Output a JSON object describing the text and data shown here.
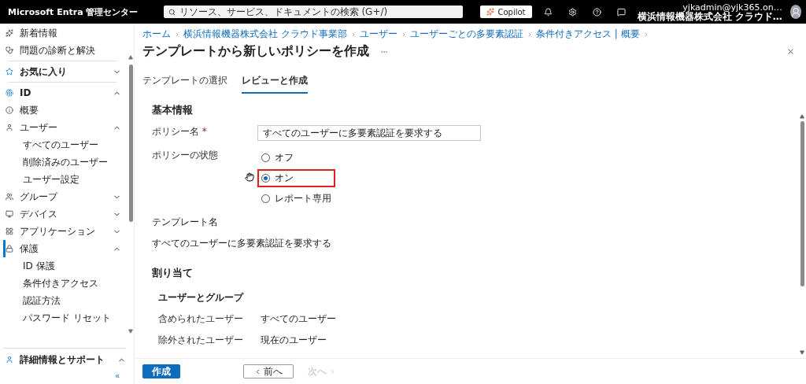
{
  "header": {
    "title": "Microsoft Entra 管理センター",
    "search": {
      "placeholder": "リソース、サービス、ドキュメントの検索 (G+/)"
    },
    "copilot": "Copilot",
    "account": {
      "email": "yjkadmin@yjk365.on…",
      "org": "横浜情報機器株式会社 クラウド…"
    }
  },
  "sidebar": {
    "items": [
      {
        "kind": "link",
        "label": "新着情報",
        "selected": false
      },
      {
        "kind": "link",
        "label": "問題の診断と解決",
        "selected": false
      },
      {
        "kind": "divider"
      },
      {
        "kind": "section",
        "label": "お気に入り",
        "expanded": false,
        "selected": false
      },
      {
        "kind": "divider"
      },
      {
        "kind": "section",
        "label": "ID",
        "expanded": true,
        "selected": false
      },
      {
        "kind": "link",
        "label": "概要",
        "selected": false
      },
      {
        "kind": "group",
        "label": "ユーザー",
        "expanded": true,
        "selected": false
      },
      {
        "kind": "sub",
        "label": "すべてのユーザー",
        "selected": false
      },
      {
        "kind": "sub",
        "label": "削除済みのユーザー",
        "selected": false
      },
      {
        "kind": "sub",
        "label": "ユーザー設定",
        "selected": false
      },
      {
        "kind": "group",
        "label": "グループ",
        "expanded": false,
        "selected": false
      },
      {
        "kind": "group",
        "label": "デバイス",
        "expanded": false,
        "selected": false
      },
      {
        "kind": "group",
        "label": "アプリケーション",
        "expanded": false,
        "selected": false
      },
      {
        "kind": "group",
        "label": "保護",
        "expanded": true,
        "selected": true
      },
      {
        "kind": "sub",
        "label": "ID 保護",
        "selected": false
      },
      {
        "kind": "sub",
        "label": "条件付きアクセス",
        "selected": false
      },
      {
        "kind": "sub",
        "label": "認証方法",
        "selected": false
      },
      {
        "kind": "sub",
        "label": "パスワード リセット",
        "selected": false
      }
    ],
    "footer": {
      "label": "詳細情報とサポート",
      "expanded": true
    },
    "collapse": "«"
  },
  "breadcrumb": [
    "ホーム",
    "横浜情報機器株式会社 クラウド事業部",
    "ユーザー",
    "ユーザーごとの多要素認証",
    "条件付きアクセス | 概要"
  ],
  "title": "テンプレートから新しいポリシーを作成",
  "tabs": [
    {
      "label": "テンプレートの選択",
      "selected": false
    },
    {
      "label": "レビューと作成",
      "selected": true
    }
  ],
  "basics": {
    "heading": "基本情報",
    "name_label": "ポリシー名",
    "required_mark": "*",
    "name_value": "すべてのユーザーに多要素認証を要求する",
    "state_label": "ポリシーの状態",
    "options": [
      {
        "label": "オフ",
        "selected": false,
        "highlighted": false
      },
      {
        "label": "オン",
        "selected": true,
        "highlighted": true
      },
      {
        "label": "レポート専用",
        "selected": false,
        "highlighted": false
      }
    ],
    "template_label": "テンプレート名",
    "template_value": "すべてのユーザーに多要素認証を要求する"
  },
  "assignments": {
    "heading": "割り当て",
    "subheading": "ユーザーとグループ",
    "rows": [
      {
        "label": "含められたユーザー",
        "value": "すべてのユーザー"
      },
      {
        "label": "除外されたユーザー",
        "value": "現在のユーザー"
      }
    ]
  },
  "footer": {
    "create": "作成",
    "prev": "前へ",
    "next": "次へ",
    "next_disabled": true
  }
}
